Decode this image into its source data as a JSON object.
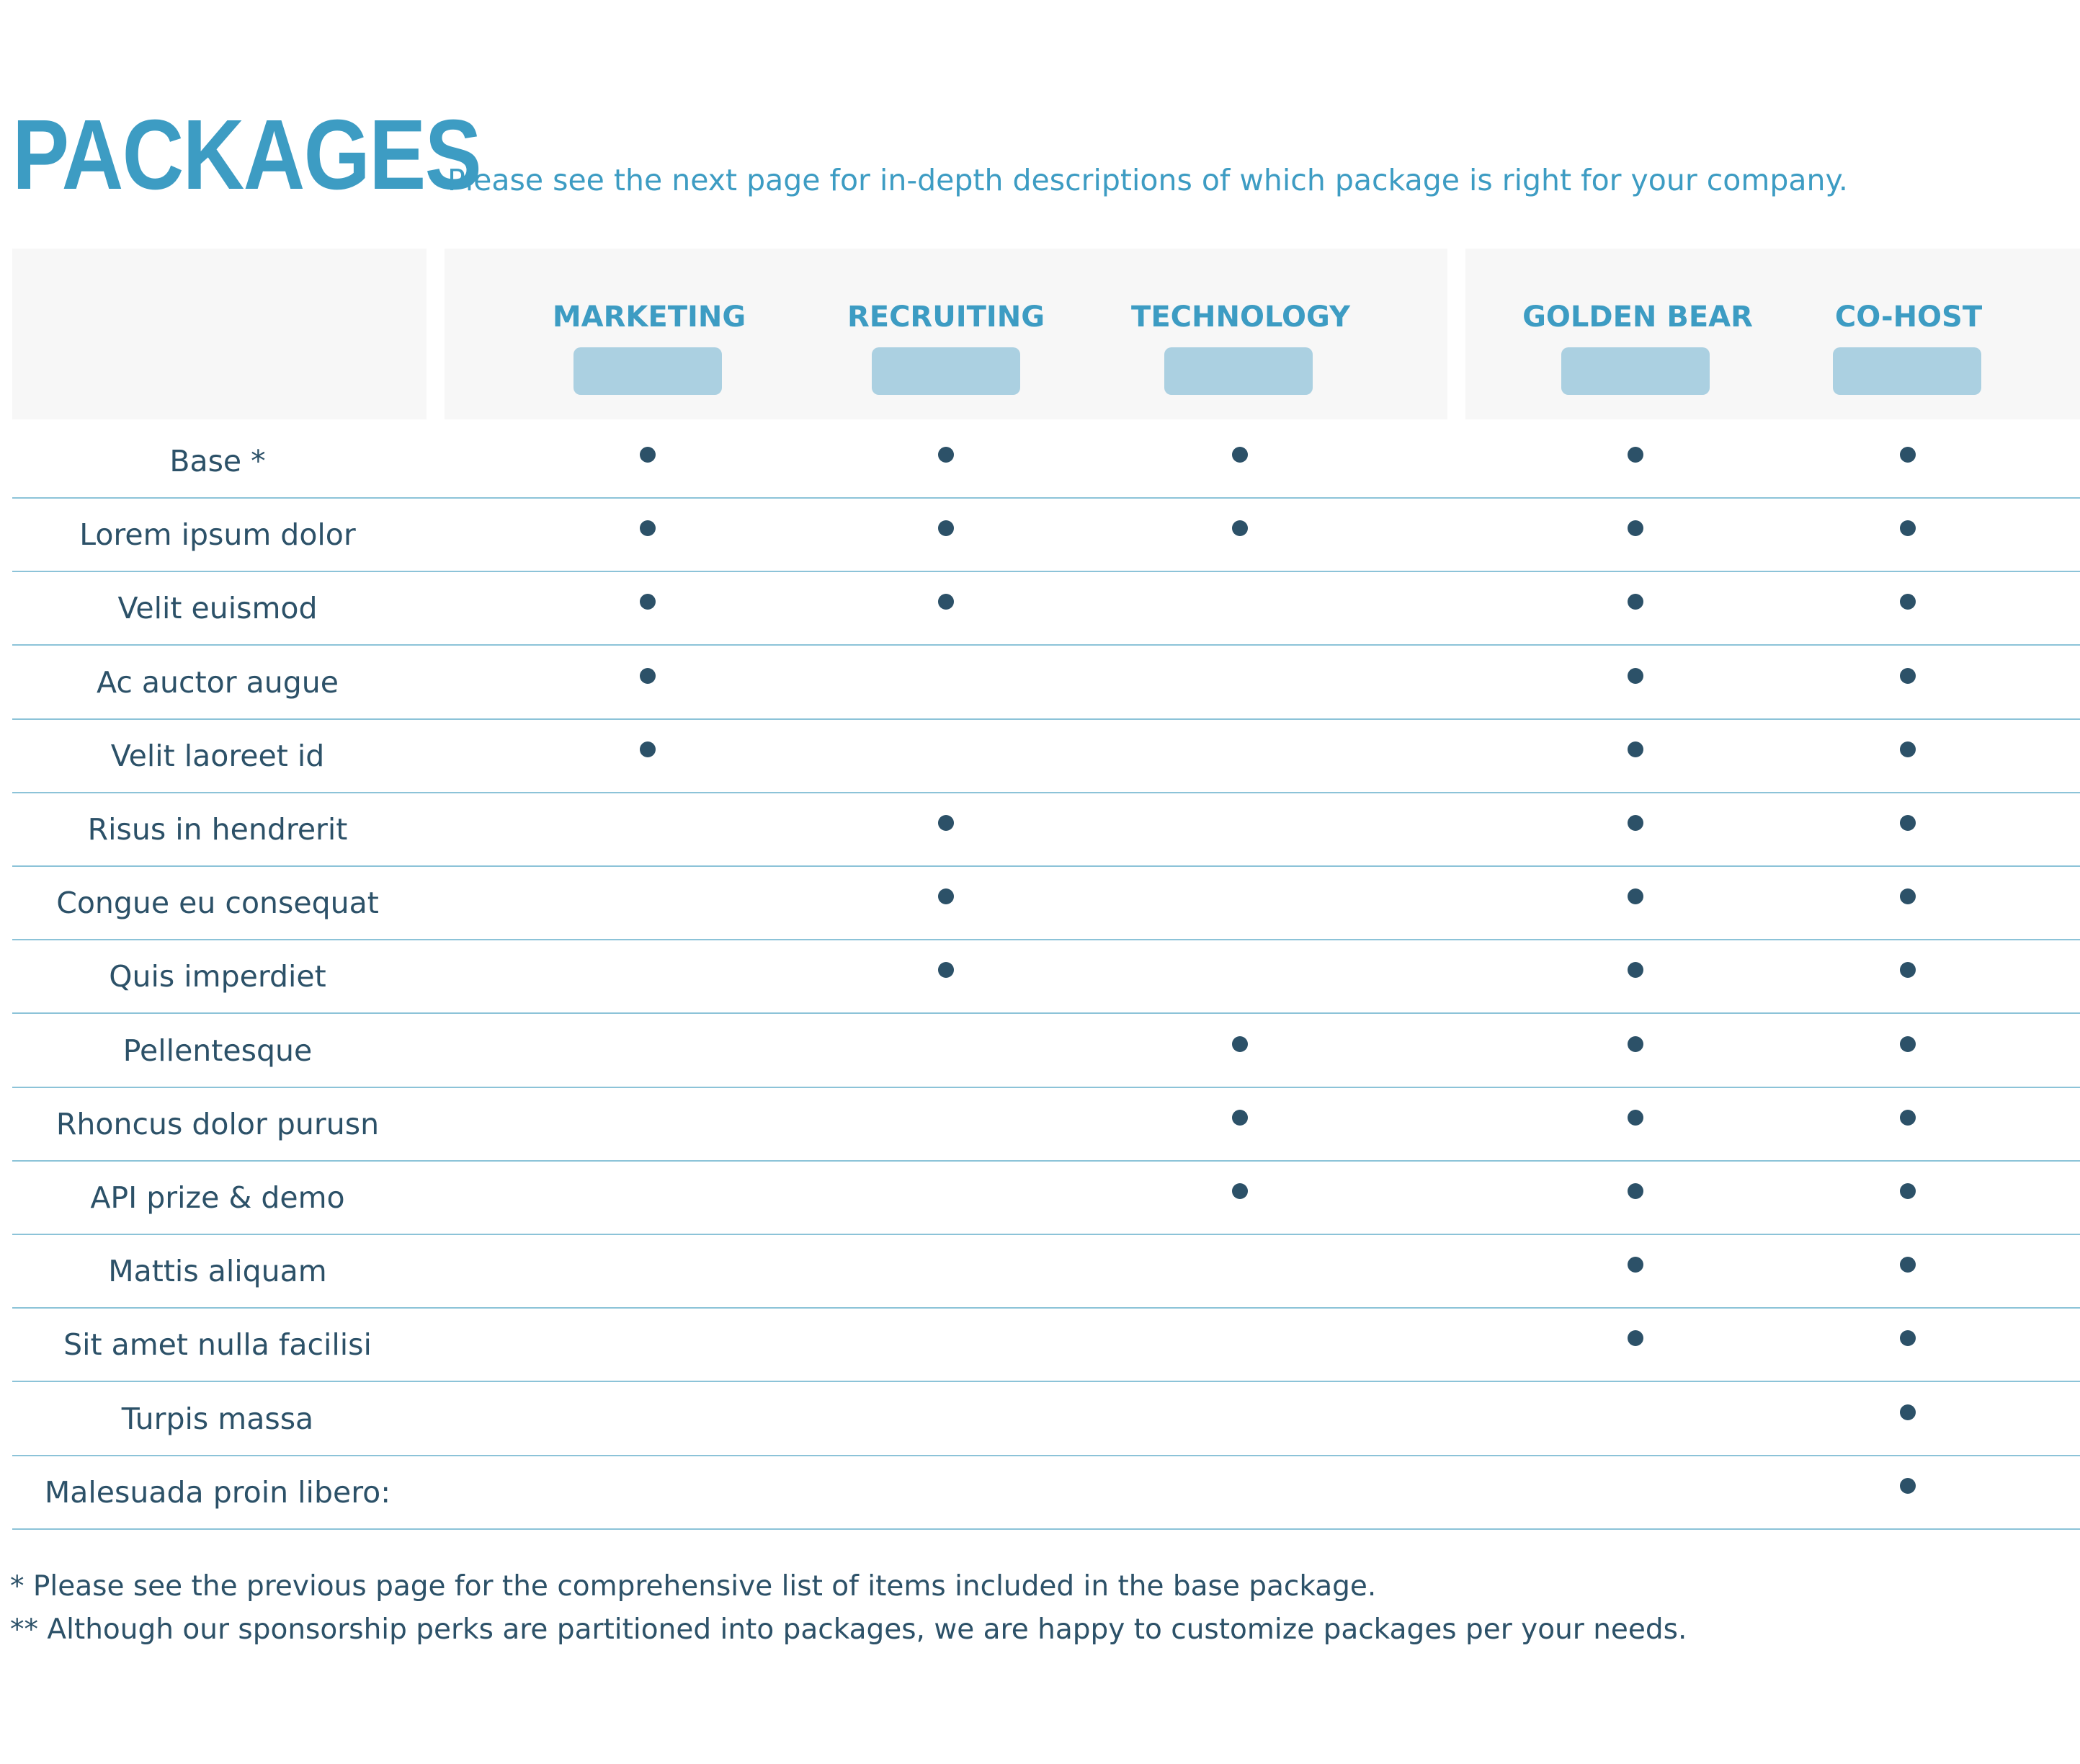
{
  "header": {
    "title": "PACKAGES",
    "subtitle": "Please see the next page for in-depth descriptions of which package is right for your company."
  },
  "packages": [
    {
      "name": "MARKETING"
    },
    {
      "name": "RECRUITING"
    },
    {
      "name": "TECHNOLOGY"
    },
    {
      "name": "GOLDEN BEAR"
    },
    {
      "name": "CO-HOST"
    }
  ],
  "rows": [
    {
      "label": "Base *",
      "included": [
        true,
        true,
        true,
        true,
        true
      ]
    },
    {
      "label": "Lorem ipsum dolor",
      "included": [
        true,
        true,
        true,
        true,
        true
      ]
    },
    {
      "label": "Velit euismod",
      "included": [
        true,
        true,
        false,
        true,
        true
      ]
    },
    {
      "label": "Ac auctor augue",
      "included": [
        true,
        false,
        false,
        true,
        true
      ]
    },
    {
      "label": "Velit laoreet id",
      "included": [
        true,
        false,
        false,
        true,
        true
      ]
    },
    {
      "label": "Risus in hendrerit",
      "included": [
        false,
        true,
        false,
        true,
        true
      ]
    },
    {
      "label": "Congue eu consequat",
      "included": [
        false,
        true,
        false,
        true,
        true
      ]
    },
    {
      "label": "Quis imperdiet",
      "included": [
        false,
        true,
        false,
        true,
        true
      ]
    },
    {
      "label": "Pellentesque",
      "included": [
        false,
        false,
        true,
        true,
        true
      ]
    },
    {
      "label": "Rhoncus dolor purusn",
      "included": [
        false,
        false,
        true,
        true,
        true
      ]
    },
    {
      "label": "API prize & demo",
      "included": [
        false,
        false,
        true,
        true,
        true
      ]
    },
    {
      "label": "Mattis aliquam",
      "included": [
        false,
        false,
        false,
        true,
        true
      ]
    },
    {
      "label": "Sit amet nulla facilisi",
      "included": [
        false,
        false,
        false,
        true,
        true
      ]
    },
    {
      "label": "Turpis massa",
      "included": [
        false,
        false,
        false,
        false,
        true
      ]
    },
    {
      "label": "Malesuada proin libero:",
      "included": [
        false,
        false,
        false,
        false,
        true
      ]
    }
  ],
  "footnotes": [
    "* Please see the previous page for the comprehensive list of items included in the base package.",
    "** Although our sponsorship perks are partitioned into packages, we are happy to customize packages per your needs."
  ],
  "colors": {
    "accent": "#3d9cc3",
    "text": "#2c5168",
    "pill": "#abd0e1",
    "header_bg": "#f7f7f7",
    "divider": "#8cc3d8"
  }
}
